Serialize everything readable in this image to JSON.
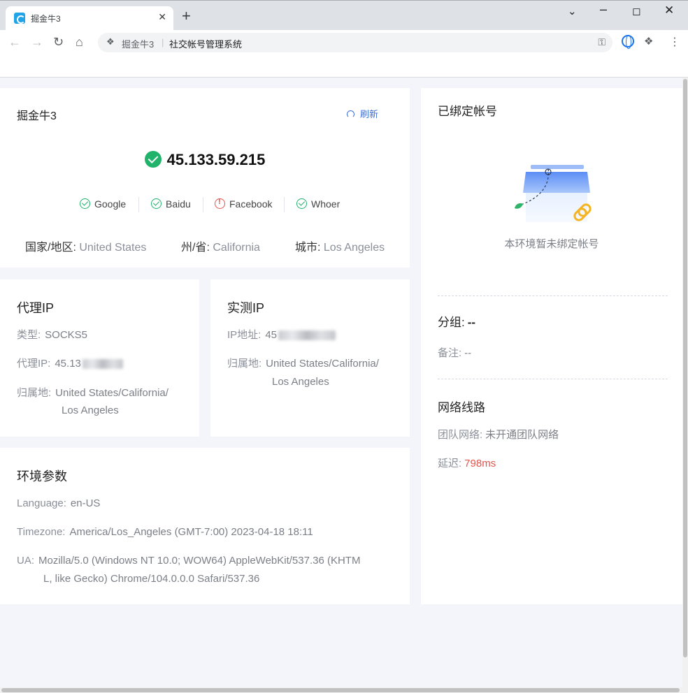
{
  "browser": {
    "tab_title": "掘金牛3",
    "tab_close": "✕",
    "new_tab": "+",
    "omnibox_title": "掘金牛3",
    "omnibox_separator": "|",
    "omnibox_url": "社交帐号管理系统"
  },
  "main": {
    "title": "掘金牛3",
    "refresh_label": "刷新",
    "ip": "45.133.59.215",
    "checks": [
      {
        "label": "Google",
        "status": "ok"
      },
      {
        "label": "Baidu",
        "status": "ok"
      },
      {
        "label": "Facebook",
        "status": "fail"
      },
      {
        "label": "Whoer",
        "status": "ok"
      }
    ],
    "country_label": "国家/地区: ",
    "country": "United States",
    "state_label": "州/省: ",
    "state": "California",
    "city_label": "城市: ",
    "city": "Los Angeles"
  },
  "proxy": {
    "title": "代理IP",
    "type_label": "类型:",
    "type": "SOCKS5",
    "ip_label": "代理IP:",
    "ip_prefix": "45.13",
    "location_label": "归属地:",
    "location_line1": "United States/California/",
    "location_line2": "Los Angeles"
  },
  "real": {
    "title": "实测IP",
    "ip_label": "IP地址:",
    "ip_prefix": "45",
    "location_label": "归属地:",
    "location_line1": "United States/California/",
    "location_line2": "Los Angeles"
  },
  "env": {
    "title": "环境参数",
    "language_label": "Language:",
    "language": "en-US",
    "timezone_label": "Timezone:",
    "timezone": "America/Los_Angeles (GMT-7:00) 2023-04-18 18:11",
    "ua_label": "UA:",
    "ua_line1": "Mozilla/5.0 (Windows NT 10.0; WOW64) AppleWebKit/537.36 (KHTM",
    "ua_line2": "L, like Gecko) Chrome/104.0.0.0 Safari/537.36"
  },
  "bound": {
    "title": "已绑定帐号",
    "empty_text": "本环境暂未绑定帐号",
    "group_label": "分组:",
    "group_value": "--",
    "note_label": "备注:",
    "note_value": "--",
    "network_title": "网络线路",
    "team_label": "团队网络:",
    "team_value": "未开通团队网络",
    "latency_label": "延迟:",
    "latency_value": "798ms",
    "latency_color": "#e5534b"
  },
  "colors": {
    "accent": "#3a6fd8",
    "success": "#21b36a",
    "danger": "#e5534b"
  }
}
